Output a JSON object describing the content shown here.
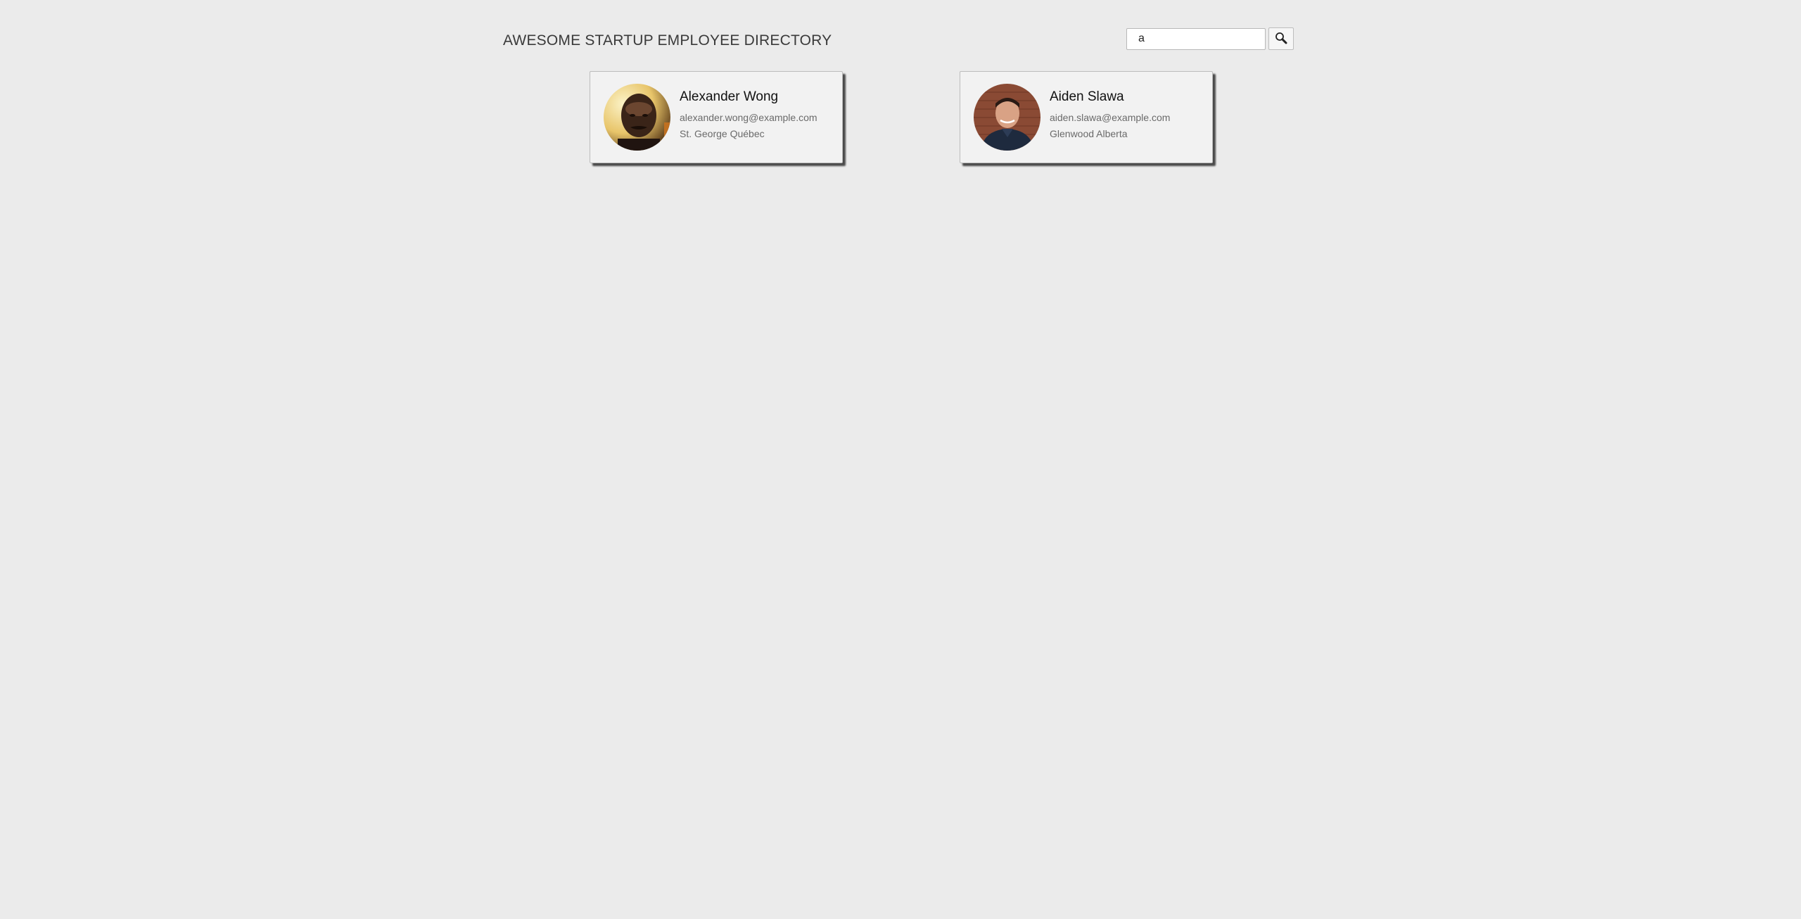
{
  "header": {
    "title": "AWESOME STARTUP EMPLOYEE DIRECTORY"
  },
  "search": {
    "value": "a",
    "button_icon": "search-icon"
  },
  "employees": [
    {
      "name": "Alexander Wong",
      "email": "alexander.wong@example.com",
      "location": "St. George Québec",
      "avatar_icon": "avatar-photo"
    },
    {
      "name": "Aiden Slawa",
      "email": "aiden.slawa@example.com",
      "location": "Glenwood Alberta",
      "avatar_icon": "avatar-photo"
    }
  ]
}
